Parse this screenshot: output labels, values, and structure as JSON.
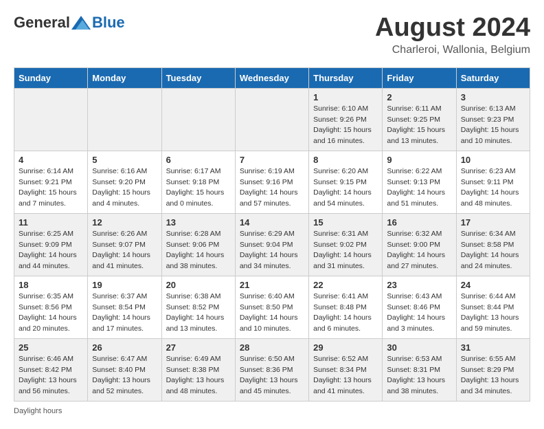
{
  "header": {
    "logo_general": "General",
    "logo_blue": "Blue",
    "month_year": "August 2024",
    "location": "Charleroi, Wallonia, Belgium"
  },
  "days_of_week": [
    "Sunday",
    "Monday",
    "Tuesday",
    "Wednesday",
    "Thursday",
    "Friday",
    "Saturday"
  ],
  "footer": {
    "daylight_label": "Daylight hours"
  },
  "weeks": [
    [
      {
        "day": "",
        "info": ""
      },
      {
        "day": "",
        "info": ""
      },
      {
        "day": "",
        "info": ""
      },
      {
        "day": "",
        "info": ""
      },
      {
        "day": "1",
        "info": "Sunrise: 6:10 AM\nSunset: 9:26 PM\nDaylight: 15 hours\nand 16 minutes."
      },
      {
        "day": "2",
        "info": "Sunrise: 6:11 AM\nSunset: 9:25 PM\nDaylight: 15 hours\nand 13 minutes."
      },
      {
        "day": "3",
        "info": "Sunrise: 6:13 AM\nSunset: 9:23 PM\nDaylight: 15 hours\nand 10 minutes."
      }
    ],
    [
      {
        "day": "4",
        "info": "Sunrise: 6:14 AM\nSunset: 9:21 PM\nDaylight: 15 hours\nand 7 minutes."
      },
      {
        "day": "5",
        "info": "Sunrise: 6:16 AM\nSunset: 9:20 PM\nDaylight: 15 hours\nand 4 minutes."
      },
      {
        "day": "6",
        "info": "Sunrise: 6:17 AM\nSunset: 9:18 PM\nDaylight: 15 hours\nand 0 minutes."
      },
      {
        "day": "7",
        "info": "Sunrise: 6:19 AM\nSunset: 9:16 PM\nDaylight: 14 hours\nand 57 minutes."
      },
      {
        "day": "8",
        "info": "Sunrise: 6:20 AM\nSunset: 9:15 PM\nDaylight: 14 hours\nand 54 minutes."
      },
      {
        "day": "9",
        "info": "Sunrise: 6:22 AM\nSunset: 9:13 PM\nDaylight: 14 hours\nand 51 minutes."
      },
      {
        "day": "10",
        "info": "Sunrise: 6:23 AM\nSunset: 9:11 PM\nDaylight: 14 hours\nand 48 minutes."
      }
    ],
    [
      {
        "day": "11",
        "info": "Sunrise: 6:25 AM\nSunset: 9:09 PM\nDaylight: 14 hours\nand 44 minutes."
      },
      {
        "day": "12",
        "info": "Sunrise: 6:26 AM\nSunset: 9:07 PM\nDaylight: 14 hours\nand 41 minutes."
      },
      {
        "day": "13",
        "info": "Sunrise: 6:28 AM\nSunset: 9:06 PM\nDaylight: 14 hours\nand 38 minutes."
      },
      {
        "day": "14",
        "info": "Sunrise: 6:29 AM\nSunset: 9:04 PM\nDaylight: 14 hours\nand 34 minutes."
      },
      {
        "day": "15",
        "info": "Sunrise: 6:31 AM\nSunset: 9:02 PM\nDaylight: 14 hours\nand 31 minutes."
      },
      {
        "day": "16",
        "info": "Sunrise: 6:32 AM\nSunset: 9:00 PM\nDaylight: 14 hours\nand 27 minutes."
      },
      {
        "day": "17",
        "info": "Sunrise: 6:34 AM\nSunset: 8:58 PM\nDaylight: 14 hours\nand 24 minutes."
      }
    ],
    [
      {
        "day": "18",
        "info": "Sunrise: 6:35 AM\nSunset: 8:56 PM\nDaylight: 14 hours\nand 20 minutes."
      },
      {
        "day": "19",
        "info": "Sunrise: 6:37 AM\nSunset: 8:54 PM\nDaylight: 14 hours\nand 17 minutes."
      },
      {
        "day": "20",
        "info": "Sunrise: 6:38 AM\nSunset: 8:52 PM\nDaylight: 14 hours\nand 13 minutes."
      },
      {
        "day": "21",
        "info": "Sunrise: 6:40 AM\nSunset: 8:50 PM\nDaylight: 14 hours\nand 10 minutes."
      },
      {
        "day": "22",
        "info": "Sunrise: 6:41 AM\nSunset: 8:48 PM\nDaylight: 14 hours\nand 6 minutes."
      },
      {
        "day": "23",
        "info": "Sunrise: 6:43 AM\nSunset: 8:46 PM\nDaylight: 14 hours\nand 3 minutes."
      },
      {
        "day": "24",
        "info": "Sunrise: 6:44 AM\nSunset: 8:44 PM\nDaylight: 13 hours\nand 59 minutes."
      }
    ],
    [
      {
        "day": "25",
        "info": "Sunrise: 6:46 AM\nSunset: 8:42 PM\nDaylight: 13 hours\nand 56 minutes."
      },
      {
        "day": "26",
        "info": "Sunrise: 6:47 AM\nSunset: 8:40 PM\nDaylight: 13 hours\nand 52 minutes."
      },
      {
        "day": "27",
        "info": "Sunrise: 6:49 AM\nSunset: 8:38 PM\nDaylight: 13 hours\nand 48 minutes."
      },
      {
        "day": "28",
        "info": "Sunrise: 6:50 AM\nSunset: 8:36 PM\nDaylight: 13 hours\nand 45 minutes."
      },
      {
        "day": "29",
        "info": "Sunrise: 6:52 AM\nSunset: 8:34 PM\nDaylight: 13 hours\nand 41 minutes."
      },
      {
        "day": "30",
        "info": "Sunrise: 6:53 AM\nSunset: 8:31 PM\nDaylight: 13 hours\nand 38 minutes."
      },
      {
        "day": "31",
        "info": "Sunrise: 6:55 AM\nSunset: 8:29 PM\nDaylight: 13 hours\nand 34 minutes."
      }
    ]
  ]
}
